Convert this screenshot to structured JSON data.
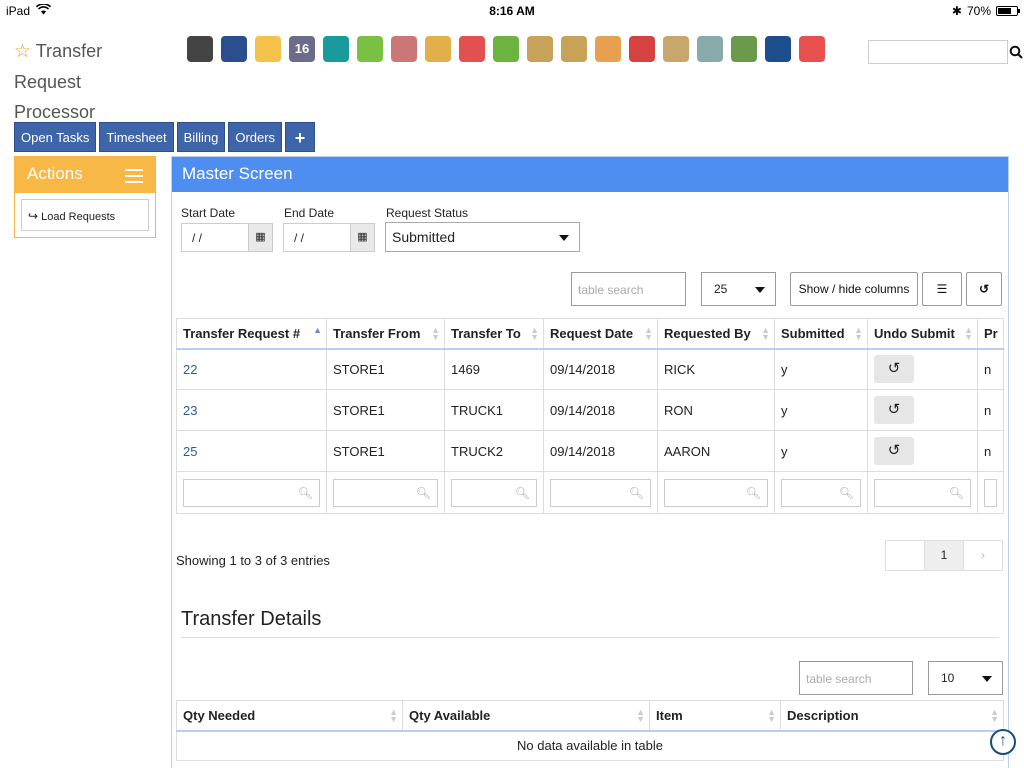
{
  "statusbar": {
    "device": "iPad",
    "time": "8:16 AM",
    "battery": "70%",
    "battery_level": 0.7
  },
  "app": {
    "title_line1": "Transfer",
    "title_line2": "Request",
    "title_line3": "Processor"
  },
  "toolbar_icons": [
    {
      "name": "bank-icon",
      "color": "#444"
    },
    {
      "name": "user-icon",
      "color": "#2b4e8c"
    },
    {
      "name": "weather-icon",
      "color": "#f2c24b"
    },
    {
      "name": "calendar-icon",
      "color": "#6b6b8a",
      "text": "16"
    },
    {
      "name": "clock-icon",
      "color": "#1a9b9b"
    },
    {
      "name": "check-icon",
      "color": "#7ac143"
    },
    {
      "name": "abacus-icon",
      "color": "#c77"
    },
    {
      "name": "magnifier-icon",
      "color": "#e2b04a"
    },
    {
      "name": "truck-icon",
      "color": "#e35050"
    },
    {
      "name": "basket-icon",
      "color": "#6cb33f"
    },
    {
      "name": "download-box-icon",
      "color": "#c9a25a"
    },
    {
      "name": "upload-box-icon",
      "color": "#c9a25a"
    },
    {
      "name": "hand-sign-icon",
      "color": "#e6a04f"
    },
    {
      "name": "money-chat-icon",
      "color": "#d64141"
    },
    {
      "name": "clipboard-icon",
      "color": "#c9a66b"
    },
    {
      "name": "pencil-icon",
      "color": "#8aa"
    },
    {
      "name": "cash-icon",
      "color": "#6a9a4a"
    },
    {
      "name": "safe-icon",
      "color": "#1c4d8c"
    },
    {
      "name": "sync-icon",
      "color": "#e85050"
    }
  ],
  "search": {
    "placeholder": "",
    "icon": "search-icon"
  },
  "nav": {
    "tabs": [
      "Open Tasks",
      "Timesheet",
      "Billing",
      "Orders"
    ],
    "plus": "+"
  },
  "actions": {
    "title": "Actions",
    "load_requests": "Load Requests"
  },
  "master": {
    "title": "Master Screen",
    "start_date_label": "Start Date",
    "start_date_value": "/ /",
    "end_date_label": "End Date",
    "end_date_value": "/ /",
    "status_label": "Request Status",
    "status_value": "Submitted",
    "table_search_placeholder": "table search",
    "page_size": "25",
    "show_hide": "Show / hide columns",
    "columns": [
      "Transfer Request #",
      "Transfer From",
      "Transfer To",
      "Request Date",
      "Requested By",
      "Submitted",
      "Undo Submit",
      "Pr"
    ],
    "rows": [
      {
        "id": "22",
        "from": "STORE1",
        "to": "1469",
        "date": "09/14/2018",
        "by": "RICK",
        "submitted": "y",
        "pr": "n"
      },
      {
        "id": "23",
        "from": "STORE1",
        "to": "TRUCK1",
        "date": "09/14/2018",
        "by": "RON",
        "submitted": "y",
        "pr": "n"
      },
      {
        "id": "25",
        "from": "STORE1",
        "to": "TRUCK2",
        "date": "09/14/2018",
        "by": "AARON",
        "submitted": "y",
        "pr": "n"
      }
    ],
    "info": "Showing 1 to 3 of 3 entries",
    "page_current": "1",
    "page_next": "›"
  },
  "details": {
    "title": "Transfer Details",
    "table_search_placeholder": "table search",
    "page_size": "10",
    "columns": [
      "Qty Needed",
      "Qty Available",
      "Item",
      "Description"
    ],
    "no_data": "No data available in table"
  }
}
